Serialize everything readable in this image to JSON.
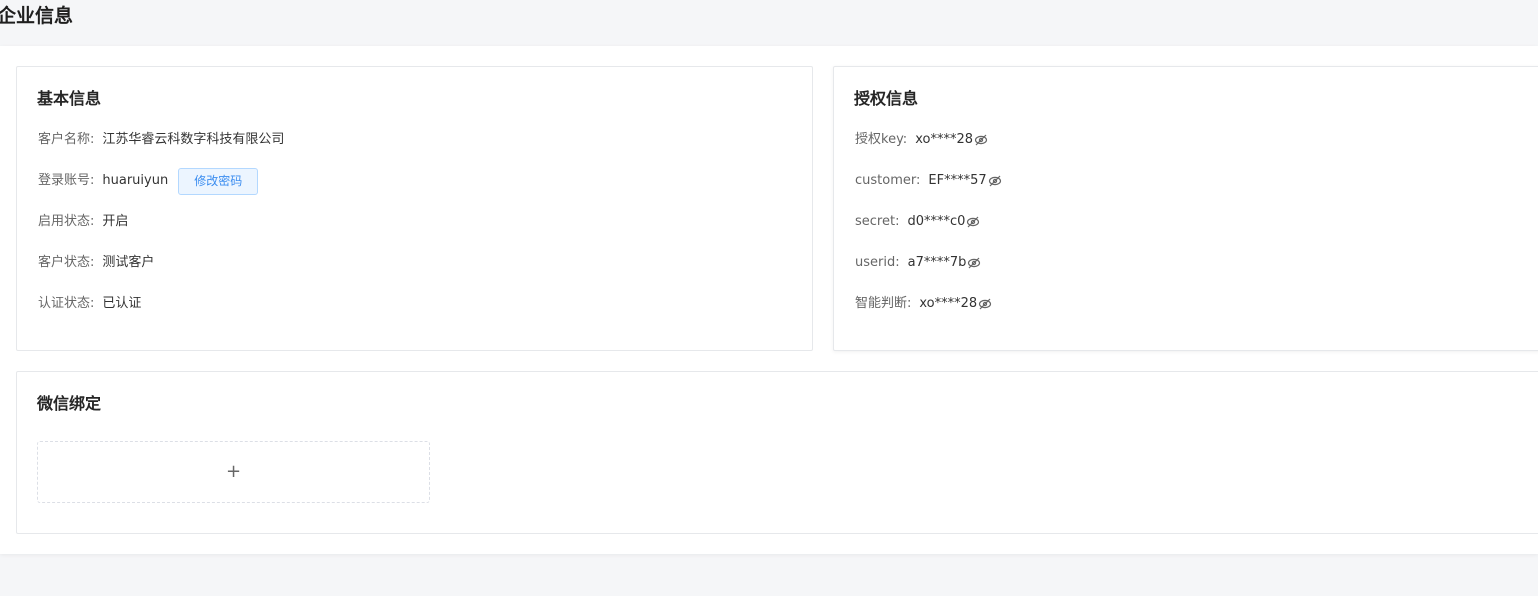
{
  "page": {
    "title": "企业信息"
  },
  "basic_info": {
    "title": "基本信息",
    "customer_name_label": "客户名称:",
    "customer_name": "江苏华睿云科数字科技有限公司",
    "login_account_label": "登录账号:",
    "login_account": "huaruiyun",
    "change_password_label": "修改密码",
    "enable_status_label": "启用状态:",
    "enable_status": "开启",
    "customer_status_label": "客户状态:",
    "customer_status": "测试客户",
    "verify_status_label": "认证状态:",
    "verify_status": "已认证"
  },
  "auth_info": {
    "title": "授权信息",
    "items": [
      {
        "label": "授权key:",
        "value": "xo****28",
        "icon": "eye-off-icon"
      },
      {
        "label": "customer:",
        "value": "EF****57",
        "icon": "eye-off-icon"
      },
      {
        "label": "secret:",
        "value": "d0****c0",
        "icon": "eye-off-icon"
      },
      {
        "label": "userid:",
        "value": "a7****7b",
        "icon": "eye-off-icon"
      },
      {
        "label": "智能判断:",
        "value": "xo****28",
        "icon": "eye-off-icon"
      }
    ]
  },
  "wechat": {
    "title": "微信绑定",
    "add_symbol": "+"
  },
  "colors": {
    "accent": "#3b8df0",
    "background": "#f5f6f8",
    "card_border": "#e6e8eb"
  }
}
